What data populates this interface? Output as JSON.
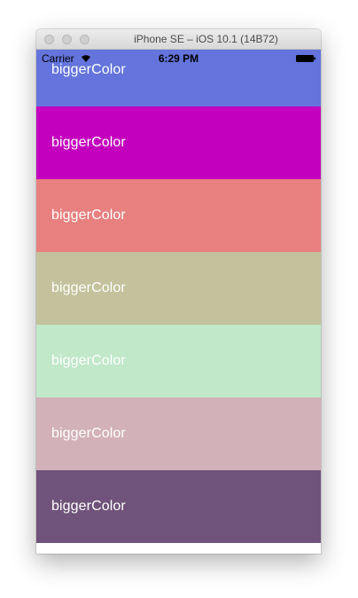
{
  "window": {
    "title": "iPhone SE – iOS 10.1 (14B72)"
  },
  "status_bar": {
    "carrier": "Carrier",
    "time": "6:29 PM",
    "wifi_icon": "wifi-icon",
    "battery_icon": "battery-icon"
  },
  "rows": [
    {
      "label": "biggerColor",
      "color": "#6474DC"
    },
    {
      "label": "biggerColor",
      "color": "#C300BD"
    },
    {
      "label": "biggerColor",
      "color": "#E88080"
    },
    {
      "label": "biggerColor",
      "color": "#C3C29C"
    },
    {
      "label": "biggerColor",
      "color": "#C0E8C9"
    },
    {
      "label": "biggerColor",
      "color": "#D2B1B8"
    },
    {
      "label": "biggerColor",
      "color": "#70537A"
    }
  ]
}
